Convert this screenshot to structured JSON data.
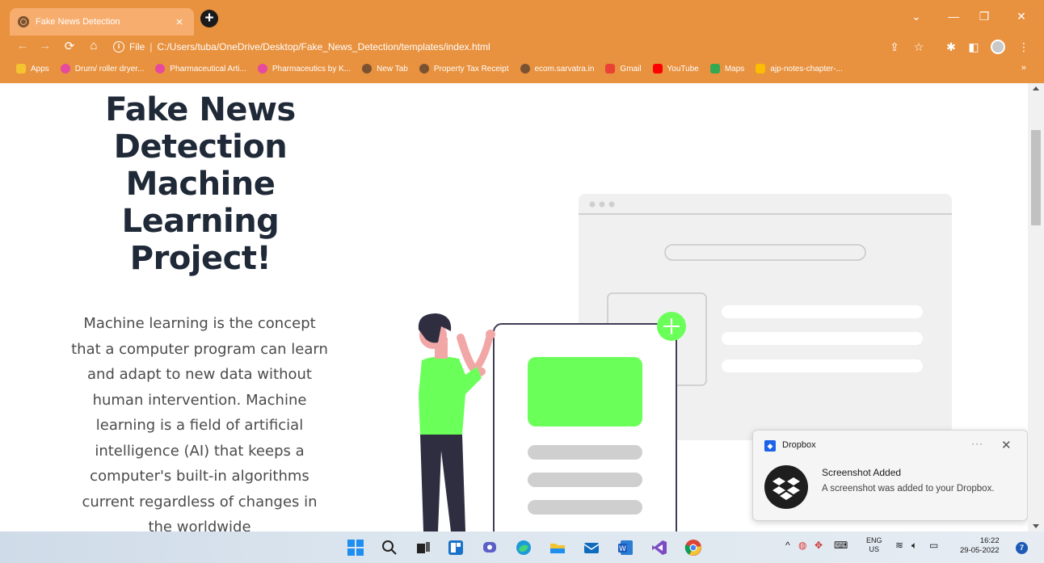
{
  "browser": {
    "tab_title": "Fake News Detection",
    "url_scheme": "File",
    "url": "C:/Users/tuba/OneDrive/Desktop/Fake_News_Detection/templates/index.html",
    "bookmarks": [
      {
        "label": "Apps",
        "icon": "apps-icon",
        "color": "#f4c430"
      },
      {
        "label": "Drum/ roller dryer...",
        "icon": "colorful-drop-icon",
        "color": "#e64aa0"
      },
      {
        "label": "Pharmaceutical Arti...",
        "icon": "colorful-drop-icon",
        "color": "#e64aa0"
      },
      {
        "label": "Pharmaceutics by K...",
        "icon": "colorful-drop-icon",
        "color": "#e64aa0"
      },
      {
        "label": "New Tab",
        "icon": "globe-icon",
        "color": "#7a5232"
      },
      {
        "label": "Property Tax Receipt",
        "icon": "globe-icon",
        "color": "#7a5232"
      },
      {
        "label": "ecom.sarvatra.in",
        "icon": "globe-icon",
        "color": "#7a5232"
      },
      {
        "label": "Gmail",
        "icon": "gmail-icon",
        "color": "#ea4335"
      },
      {
        "label": "YouTube",
        "icon": "youtube-icon",
        "color": "#ff0000"
      },
      {
        "label": "Maps",
        "icon": "maps-icon",
        "color": "#34a853"
      },
      {
        "label": "ajp-notes-chapter-...",
        "icon": "drive-icon",
        "color": "#fbbc04"
      }
    ],
    "more_bookmarks": "»"
  },
  "page": {
    "title": "Fake News Detection Machine Learning Project!",
    "description": "Machine learning is the concept that a computer program can learn and adapt to new data without human intervention. Machine learning is a field of artificial intelligence (AI) that keeps a computer's built-in algorithms current regardless of changes in the worldwide"
  },
  "notification": {
    "app": "Dropbox",
    "title": "Screenshot Added",
    "body": "A screenshot was added to your Dropbox.",
    "more": "···"
  },
  "taskbar": {
    "lang_line1": "ENG",
    "lang_line2": "US",
    "time": "16:22",
    "date": "29-05-2022",
    "badge": "7"
  },
  "colors": {
    "chrome": "#e8913e",
    "accent_green": "#6bff5a",
    "heading": "#1f2937"
  }
}
